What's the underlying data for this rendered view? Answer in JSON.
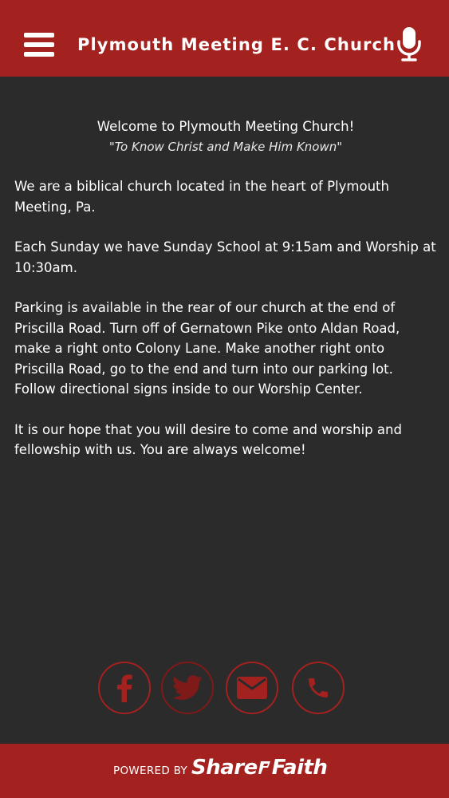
{
  "header": {
    "title": "Plymouth Meeting E. C. Church",
    "menu_icon": "hamburger-menu-icon",
    "mic_icon": "microphone-icon",
    "background_color": "#a3211f"
  },
  "content": {
    "welcome": "Welcome to Plymouth Meeting Church!",
    "tagline": "\"To Know Christ and Make Him Known\"",
    "paragraphs": [
      "We are a biblical church located in the heart of Plymouth Meeting, Pa.",
      "Each Sunday we have Sunday School at 9:15am and Worship at 10:30am.",
      "Parking is available in the rear of our church at the end of Priscilla Road. Turn off of Gernatown Pike onto Aldan Road, make a right onto Colony Lane. Make another right onto Priscilla Road, go to the end and turn into our parking lot. Follow directional signs inside to our Worship Center.",
      "It is our hope that you will desire to come and worship and fellowship with us. You are always welcome!"
    ]
  },
  "social": [
    {
      "name": "facebook",
      "icon": "facebook-icon"
    },
    {
      "name": "twitter",
      "icon": "twitter-icon"
    },
    {
      "name": "email",
      "icon": "envelope-icon"
    },
    {
      "name": "phone",
      "icon": "phone-icon"
    }
  ],
  "footer": {
    "powered_by": "POWERED BY",
    "brand_left": "Share",
    "brand_right": "Faith"
  },
  "colors": {
    "accent": "#a3211f",
    "background": "#2b2b2b",
    "text": "#ffffff"
  }
}
